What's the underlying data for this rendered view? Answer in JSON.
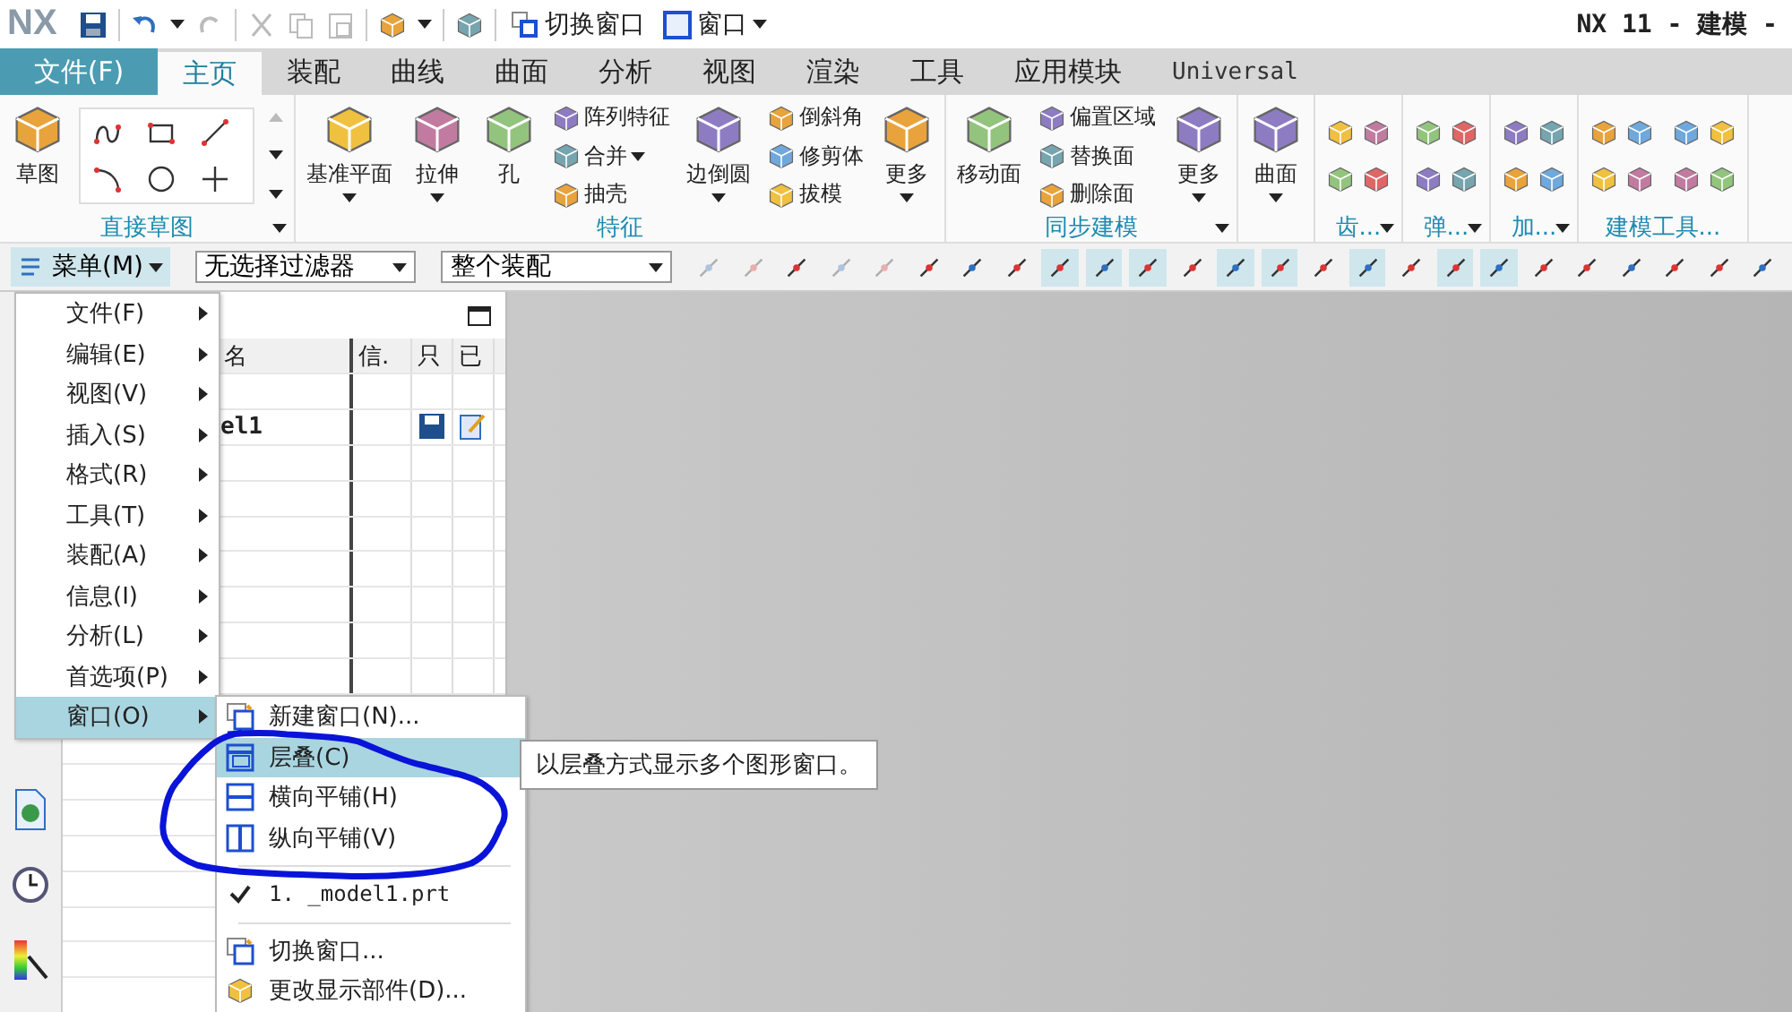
{
  "app": {
    "logo": "NX",
    "title": "NX 11 - 建模 -"
  },
  "quick_access": {
    "switch_window": "切换窗口",
    "window": "窗口"
  },
  "file_tab": "文件(F)",
  "tabs": [
    {
      "label": "主页",
      "selected": true
    },
    {
      "label": "装配",
      "selected": false
    },
    {
      "label": "曲线",
      "selected": false
    },
    {
      "label": "曲面",
      "selected": false
    },
    {
      "label": "分析",
      "selected": false
    },
    {
      "label": "视图",
      "selected": false
    },
    {
      "label": "渲染",
      "selected": false
    },
    {
      "label": "工具",
      "selected": false
    },
    {
      "label": "应用模块",
      "selected": false
    },
    {
      "label": "Universal",
      "selected": false
    }
  ],
  "ribbon": [
    {
      "label": "直接草图",
      "dropdown": true,
      "items": [
        {
          "kind": "large",
          "label": "草图",
          "dropdown": false
        },
        {
          "kind": "gallery"
        }
      ]
    },
    {
      "label": "特征",
      "dropdown": false,
      "items": [
        {
          "kind": "large",
          "label": "基准平面",
          "dropdown": true
        },
        {
          "kind": "large",
          "label": "拉伸",
          "dropdown": true
        },
        {
          "kind": "large",
          "label": "孔",
          "dropdown": false
        },
        {
          "kind": "column",
          "entries": [
            {
              "label": "阵列特征",
              "dropdown": false
            },
            {
              "label": "合并",
              "dropdown": true
            },
            {
              "label": "抽壳",
              "dropdown": false
            }
          ]
        },
        {
          "kind": "large",
          "label": "边倒圆",
          "dropdown": true
        },
        {
          "kind": "column",
          "entries": [
            {
              "label": "倒斜角",
              "dropdown": false
            },
            {
              "label": "修剪体",
              "dropdown": false
            },
            {
              "label": "拔模",
              "dropdown": false
            }
          ]
        },
        {
          "kind": "large",
          "label": "更多",
          "dropdown": true
        }
      ]
    },
    {
      "label": "同步建模",
      "dropdown": true,
      "items": [
        {
          "kind": "large",
          "label": "移动面",
          "dropdown": false
        },
        {
          "kind": "column",
          "entries": [
            {
              "label": "偏置区域",
              "dropdown": false
            },
            {
              "label": "替换面",
              "dropdown": false
            },
            {
              "label": "删除面",
              "dropdown": false
            }
          ]
        },
        {
          "kind": "large",
          "label": "更多",
          "dropdown": true
        }
      ]
    },
    {
      "items": [
        {
          "kind": "large",
          "label": "曲面",
          "dropdown": true
        }
      ]
    },
    {
      "label": "齿...",
      "dropdown": true,
      "items": [
        {
          "kind": "icons"
        }
      ]
    },
    {
      "label": "弹...",
      "dropdown": true,
      "items": [
        {
          "kind": "icons"
        }
      ]
    },
    {
      "label": "加...",
      "dropdown": true,
      "items": [
        {
          "kind": "icons"
        }
      ]
    },
    {
      "label": "建模工具...",
      "dropdown": false,
      "items": [
        {
          "kind": "icons"
        },
        {
          "kind": "icons"
        }
      ]
    }
  ],
  "toolbar": {
    "menu_button": "菜单(M)",
    "filter": "无选择过滤器",
    "scope": "整个装配",
    "icons": [
      {
        "selected": false,
        "disabled": true
      },
      {
        "selected": false,
        "disabled": true
      },
      {
        "selected": false,
        "disabled": false
      },
      {
        "selected": false,
        "disabled": true
      },
      {
        "selected": false,
        "disabled": true
      },
      {
        "selected": false,
        "disabled": false
      },
      {
        "selected": false,
        "disabled": false
      },
      {
        "selected": false,
        "disabled": false
      },
      {
        "selected": true,
        "disabled": false
      },
      {
        "selected": true,
        "disabled": false
      },
      {
        "selected": true,
        "disabled": false
      },
      {
        "selected": false,
        "disabled": false
      },
      {
        "selected": true,
        "disabled": false
      },
      {
        "selected": true,
        "disabled": false
      },
      {
        "selected": false,
        "disabled": false
      },
      {
        "selected": true,
        "disabled": false
      },
      {
        "selected": false,
        "disabled": false
      },
      {
        "selected": true,
        "disabled": false
      },
      {
        "selected": true,
        "disabled": false
      },
      {
        "selected": false,
        "disabled": false
      },
      {
        "selected": false,
        "disabled": false
      },
      {
        "selected": false,
        "disabled": false
      },
      {
        "selected": false,
        "disabled": false
      },
      {
        "selected": false,
        "disabled": false
      },
      {
        "selected": false,
        "disabled": false
      }
    ]
  },
  "navigator": {
    "columns": [
      "名",
      "信.",
      "只",
      "已"
    ],
    "rows": [
      {
        "name": "el1"
      }
    ]
  },
  "menu": [
    {
      "label": "文件(F)",
      "selected": false
    },
    {
      "label": "编辑(E)",
      "selected": false
    },
    {
      "label": "视图(V)",
      "selected": false
    },
    {
      "label": "插入(S)",
      "selected": false
    },
    {
      "label": "格式(R)",
      "selected": false
    },
    {
      "label": "工具(T)",
      "selected": false
    },
    {
      "label": "装配(A)",
      "selected": false
    },
    {
      "label": "信息(I)",
      "selected": false
    },
    {
      "label": "分析(L)",
      "selected": false
    },
    {
      "label": "首选项(P)",
      "selected": false
    },
    {
      "label": "窗口(O)",
      "selected": true
    }
  ],
  "submenu": [
    {
      "kind": "item",
      "label": "新建窗口(N)...",
      "selected": false
    },
    {
      "kind": "item",
      "label": "层叠(C)",
      "selected": true
    },
    {
      "kind": "item",
      "label": "横向平铺(H)",
      "selected": false
    },
    {
      "kind": "item",
      "label": "纵向平铺(V)",
      "selected": false
    },
    {
      "kind": "separator"
    },
    {
      "kind": "check",
      "label": "1. _model1.prt",
      "checked": true,
      "selected": false
    },
    {
      "kind": "separator"
    },
    {
      "kind": "item",
      "label": "切换窗口...",
      "selected": false
    },
    {
      "kind": "item",
      "label": "更改显示部件(D)...",
      "selected": false
    }
  ],
  "tooltip": "以层叠方式显示多个图形窗口。"
}
